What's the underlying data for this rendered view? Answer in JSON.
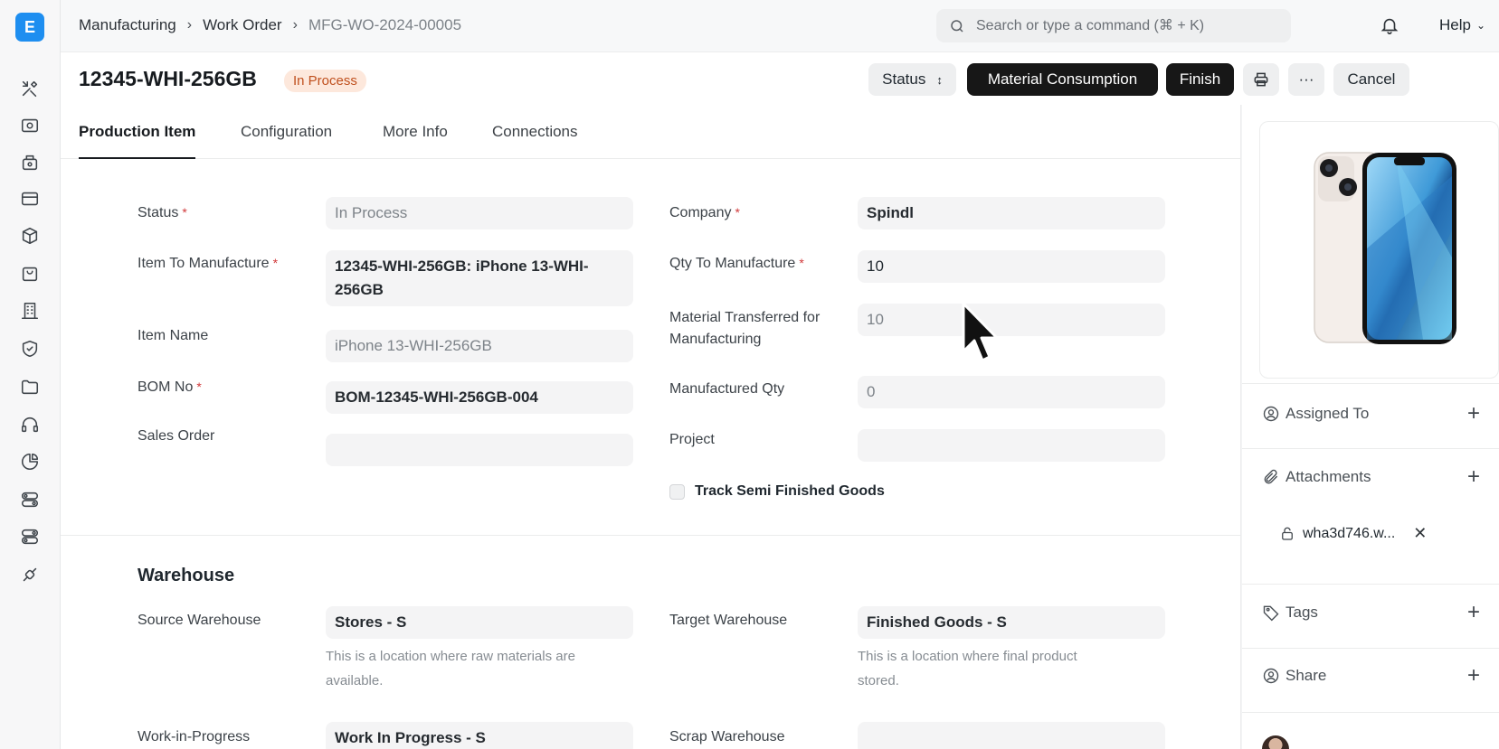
{
  "app": {
    "logo_letter": "E"
  },
  "breadcrumb": [
    "Manufacturing",
    "Work Order",
    "MFG-WO-2024-00005"
  ],
  "search": {
    "placeholder": "Search or type a command (⌘ + K)"
  },
  "header": {
    "help_label": "Help",
    "title": "12345-WHI-256GB",
    "status_badge": "In Process",
    "status_button": "Status",
    "material_button": "Material Consumption",
    "finish_button": "Finish",
    "more_button": "···",
    "cancel_button": "Cancel"
  },
  "tabs": [
    "Production Item",
    "Configuration",
    "More Info",
    "Connections"
  ],
  "form": {
    "status_label": "Status",
    "status_value": "In Process",
    "item_label": "Item To Manufacture",
    "item_value_line1": "12345-WHI-256GB: iPhone 13-WHI-",
    "item_value_line2": "256GB",
    "item_name_label": "Item Name",
    "item_name_value": "iPhone 13-WHI-256GB",
    "bom_label": "BOM No",
    "bom_value": "BOM-12345-WHI-256GB-004",
    "sales_order_label": "Sales Order",
    "sales_order_value": "",
    "company_label": "Company",
    "company_value": "Spindl",
    "qty_label": "Qty To Manufacture",
    "qty_value": "10",
    "transferred_label_line1": "Material Transferred for",
    "transferred_label_line2": "Manufacturing",
    "transferred_value": "10",
    "manufactured_label": "Manufactured Qty",
    "manufactured_value": "0",
    "project_label": "Project",
    "project_value": "",
    "track_label": "Track Semi Finished Goods",
    "required_mark": "*"
  },
  "warehouse": {
    "title": "Warehouse",
    "source_label": "Source Warehouse",
    "source_value": "Stores - S",
    "source_help_line1": "This is a location where raw materials are",
    "source_help_line2": "available.",
    "target_label": "Target Warehouse",
    "target_value": "Finished Goods - S",
    "target_help_line1": "This is a location where final product",
    "target_help_line2": "stored.",
    "wip_label": "Work-in-Progress",
    "wip_value": "Work In Progress - S",
    "scrap_label": "Scrap Warehouse"
  },
  "sidebar_right": {
    "assigned_label": "Assigned To",
    "attachments_label": "Attachments",
    "attachment_file": "wha3d746.w...",
    "tags_label": "Tags",
    "share_label": "Share",
    "plus": "+",
    "remove": "✕"
  },
  "icons": {
    "sidebar": [
      "tools-icon",
      "eye-icon",
      "cash-register-icon",
      "card-icon",
      "box-icon",
      "bag-icon",
      "building-icon",
      "shield-icon",
      "folder-icon",
      "headset-icon",
      "pie-chart-icon",
      "toggle-icon",
      "toggle-icon",
      "integration-icon"
    ]
  },
  "colors": {
    "logo": "#1e8ef0",
    "badge_bg": "#fde8dc",
    "badge_text": "#c0501e",
    "primary_button": "#171717"
  }
}
